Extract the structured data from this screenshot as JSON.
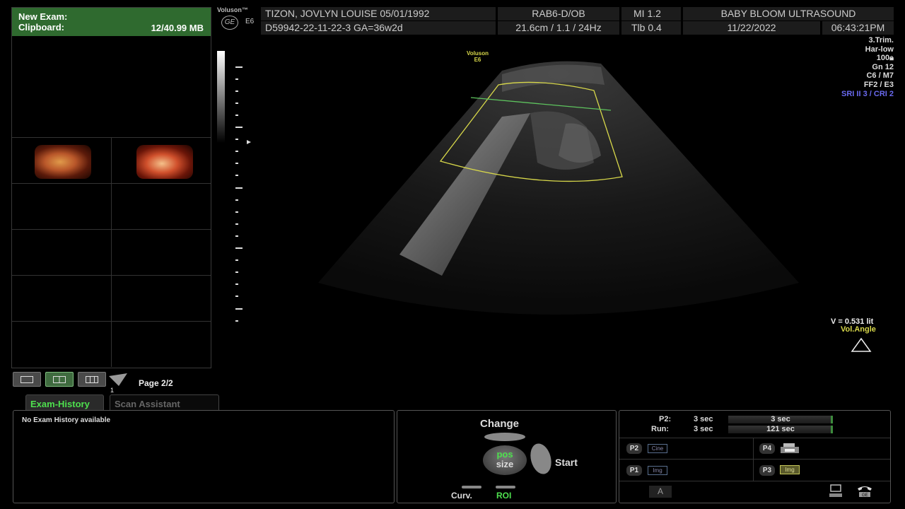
{
  "clipboard": {
    "title": "New Exam:",
    "subtitle": "Clipboard:",
    "size": "12/40.99 MB"
  },
  "page": {
    "label": "Page 2/2",
    "sub": "1"
  },
  "tabs": [
    {
      "label": "Exam-History"
    },
    {
      "label": "Scan Assistant"
    }
  ],
  "history": {
    "message": "No Exam History available"
  },
  "header": {
    "brand": "Voluson™",
    "model": "E6",
    "logo": "GE",
    "patient": "TIZON, JOVLYN LOUISE  05/01/1992",
    "exam_id": "D59942-22-11-22-3  GA=36w2d",
    "probe": "RAB6-D/OB",
    "scan": "21.6cm / 1.1 / 24Hz",
    "mi": "MI  1.2",
    "tib": "Tlb  0.4",
    "institution": "BABY BLOOM ULTRASOUND",
    "date": "11/22/2022",
    "time": "06:43:21PM"
  },
  "params": {
    "trim": "3.Trim.",
    "har": "Har-low",
    "power": "100",
    "gn": "Gn  12",
    "c": "C6 / M7",
    "ff": "FF2 / E3",
    "sri": "SRI II 3 / CRI 2"
  },
  "volume": {
    "v": "V = 0.531 lit",
    "angle": "Vol.Angle"
  },
  "image_watermark": {
    "brand": "Voluson",
    "model": "E6"
  },
  "control": {
    "change": "Change",
    "pos": "pos",
    "size": "size",
    "start": "Start",
    "curv": "Curv.",
    "roi": "ROI"
  },
  "p_panel": {
    "p2_label": "P2:",
    "p2_val": "3 sec",
    "p2_bar": "3 sec",
    "run_label": "Run:",
    "run_val": "3 sec",
    "run_bar": "121 sec",
    "p2": "P2",
    "p2_chip": "Cine",
    "p4": "P4",
    "p1": "P1",
    "p1_chip": "Img",
    "p3": "P3",
    "p3_chip": "Img",
    "a": "A"
  },
  "colors": {
    "accent_green": "#4ee04e",
    "header_green": "#2f6a2f",
    "roi_yellow": "#d8d84a",
    "sri_blue": "#6a6af0"
  }
}
